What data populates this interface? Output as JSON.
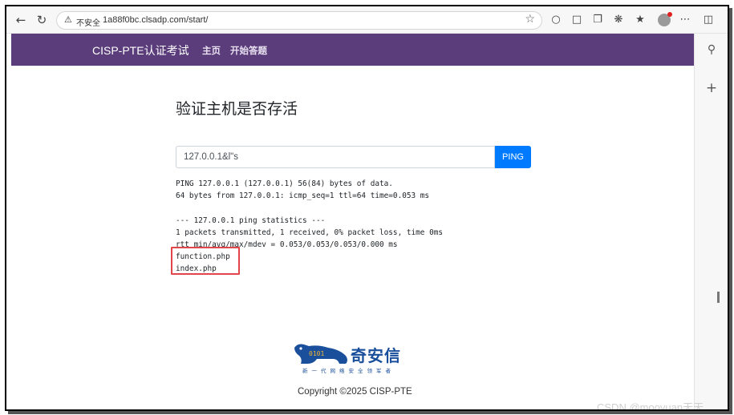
{
  "browser": {
    "insecure_label": "不安全",
    "url": "1a88f0bc.clsadp.com/start/"
  },
  "navbar": {
    "brand": "CISP-PTE认证考试",
    "links": [
      "主页",
      "开始答题"
    ]
  },
  "main": {
    "heading": "验证主机是否存活",
    "input_value": "127.0.0.1&l\"s",
    "ping_button": "PING",
    "output_lines": [
      "PING 127.0.0.1 (127.0.0.1) 56(84) bytes of data.",
      "64 bytes from 127.0.0.1: icmp_seq=1 ttl=64 time=0.053 ms",
      "",
      "--- 127.0.0.1 ping statistics ---",
      "1 packets transmitted, 1 received, 0% packet loss, time 0ms",
      "rtt min/avg/max/mdev = 0.053/0.053/0.053/0.000 ms",
      "function.php",
      "index.php"
    ]
  },
  "footer": {
    "logo_name": "奇安信",
    "logo_slogan": "新一代网络安全领军者",
    "copyright": "Copyright ©2025 CISP-PTE"
  },
  "watermark": "CSDN @mooyuan天天",
  "colors": {
    "navbar": "#5a3d7a",
    "ping_button": "#007bff",
    "highlight_box": "#e0464a",
    "logo": "#1a4f9c"
  }
}
